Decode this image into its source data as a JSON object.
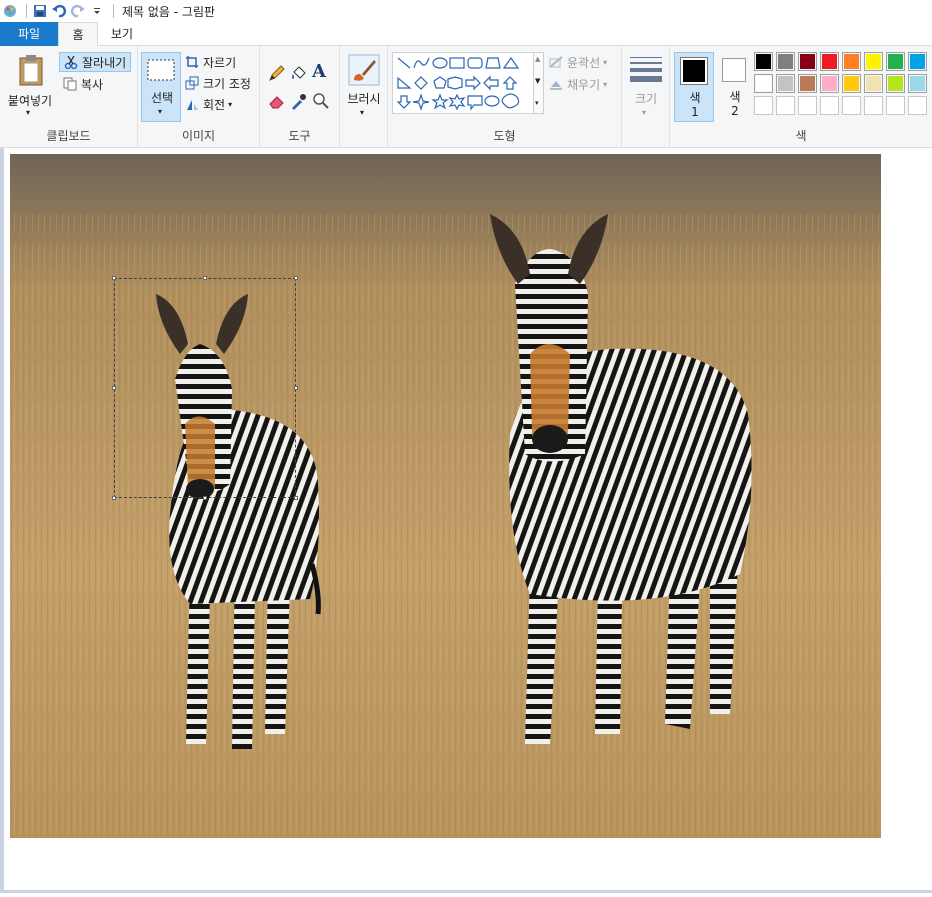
{
  "window": {
    "title": "제목 없음 - 그림판"
  },
  "tabs": {
    "file": "파일",
    "home": "홈",
    "view": "보기"
  },
  "clipboard": {
    "paste": "붙여넣기",
    "cut": "잘라내기",
    "copy": "복사",
    "label": "클립보드"
  },
  "image": {
    "select": "선택",
    "crop": "자르기",
    "resize": "크기 조정",
    "rotate": "회전",
    "label": "이미지"
  },
  "tools": {
    "label": "도구"
  },
  "brushes": {
    "label": "브러시"
  },
  "shapes": {
    "outline": "윤곽선",
    "fill": "채우기",
    "label": "도형"
  },
  "size": {
    "label": "크기"
  },
  "colors": {
    "color1_label": "색",
    "color1_num": "1",
    "color2_label": "색",
    "color2_num": "2",
    "label": "색",
    "color1": "#000000",
    "color2": "#ffffff",
    "palette_row1": [
      "#000000",
      "#7f7f7f",
      "#880015",
      "#ed1c24",
      "#ff7f27",
      "#fff200",
      "#22b14c",
      "#00a2e8"
    ],
    "palette_row2": [
      "#ffffff",
      "#c3c3c3",
      "#b97a57",
      "#ffaec9",
      "#ffc90e",
      "#efe4b0",
      "#b5e61d",
      "#99d9ea"
    ]
  },
  "canvas": {
    "selection": "rectangle"
  }
}
